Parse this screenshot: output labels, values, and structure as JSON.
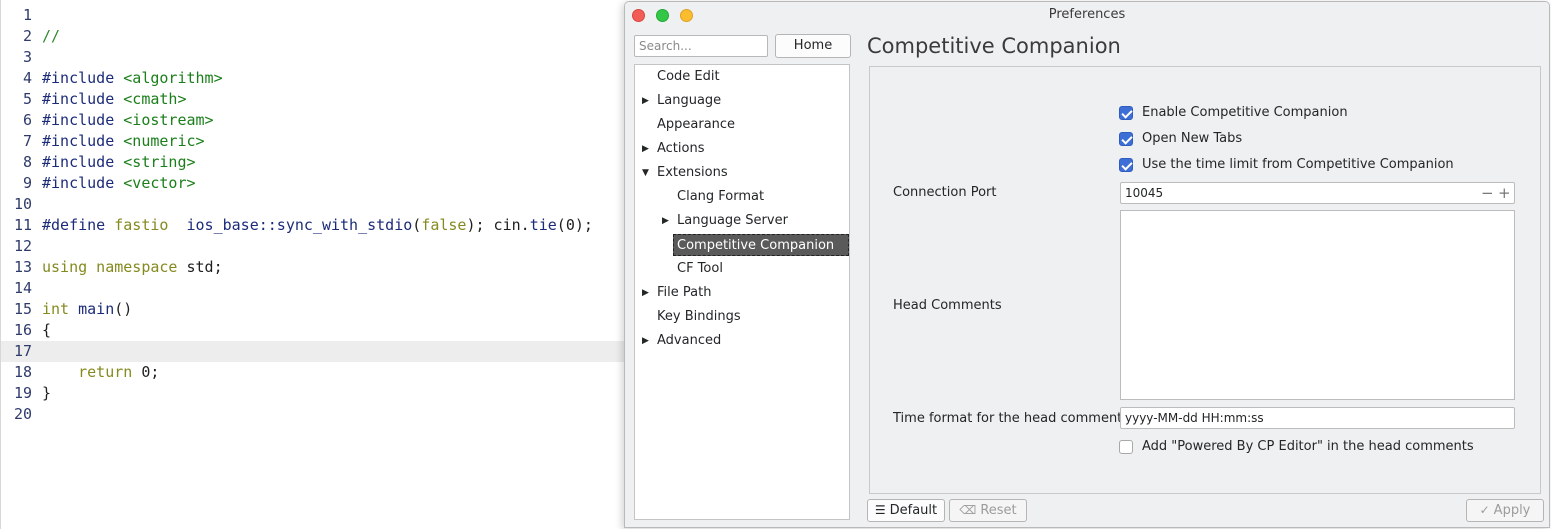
{
  "editor": {
    "lines": [
      {
        "n": "1",
        "tokens": []
      },
      {
        "n": "2",
        "tokens": [
          {
            "t": "//",
            "c": "com"
          }
        ]
      },
      {
        "n": "3",
        "tokens": []
      },
      {
        "n": "4",
        "tokens": [
          {
            "t": "#include ",
            "c": "pp"
          },
          {
            "t": "<algorithm>",
            "c": "inc"
          }
        ]
      },
      {
        "n": "5",
        "tokens": [
          {
            "t": "#include ",
            "c": "pp"
          },
          {
            "t": "<cmath>",
            "c": "inc"
          }
        ]
      },
      {
        "n": "6",
        "tokens": [
          {
            "t": "#include ",
            "c": "pp"
          },
          {
            "t": "<iostream>",
            "c": "inc"
          }
        ]
      },
      {
        "n": "7",
        "tokens": [
          {
            "t": "#include ",
            "c": "pp"
          },
          {
            "t": "<numeric>",
            "c": "inc"
          }
        ]
      },
      {
        "n": "8",
        "tokens": [
          {
            "t": "#include ",
            "c": "pp"
          },
          {
            "t": "<string>",
            "c": "inc"
          }
        ]
      },
      {
        "n": "9",
        "tokens": [
          {
            "t": "#include ",
            "c": "pp"
          },
          {
            "t": "<vector>",
            "c": "inc"
          }
        ]
      },
      {
        "n": "10",
        "tokens": []
      },
      {
        "n": "11",
        "tokens": [
          {
            "t": "#define ",
            "c": "pp"
          },
          {
            "t": "fastio  ",
            "c": "kw"
          },
          {
            "t": "ios_base::sync_with_stdio",
            "c": "fn"
          },
          {
            "t": "(",
            "c": ""
          },
          {
            "t": "false",
            "c": "kw"
          },
          {
            "t": "); cin.",
            "c": ""
          },
          {
            "t": "tie",
            "c": "fn"
          },
          {
            "t": "(",
            "c": ""
          },
          {
            "t": "0",
            "c": "num"
          },
          {
            "t": ");",
            "c": ""
          }
        ]
      },
      {
        "n": "12",
        "tokens": []
      },
      {
        "n": "13",
        "tokens": [
          {
            "t": "using namespace ",
            "c": "kw"
          },
          {
            "t": "std;",
            "c": ""
          }
        ]
      },
      {
        "n": "14",
        "tokens": []
      },
      {
        "n": "15",
        "tokens": [
          {
            "t": "int ",
            "c": "kw"
          },
          {
            "t": "main",
            "c": "fn"
          },
          {
            "t": "()",
            "c": ""
          }
        ]
      },
      {
        "n": "16",
        "tokens": [
          {
            "t": "{",
            "c": ""
          }
        ]
      },
      {
        "n": "17",
        "tokens": [],
        "current": true
      },
      {
        "n": "18",
        "tokens": [
          {
            "t": "    ",
            "c": ""
          },
          {
            "t": "return ",
            "c": "kw"
          },
          {
            "t": "0;",
            "c": ""
          }
        ]
      },
      {
        "n": "19",
        "tokens": [
          {
            "t": "}",
            "c": ""
          }
        ]
      },
      {
        "n": "20",
        "tokens": []
      }
    ]
  },
  "window": {
    "title": "Preferences",
    "search_placeholder": "Search...",
    "home_label": "Home"
  },
  "tree": [
    {
      "label": "Code Edit",
      "level": 0,
      "arrow": "",
      "selected": false
    },
    {
      "label": "Language",
      "level": 0,
      "arrow": "▶",
      "selected": false
    },
    {
      "label": "Appearance",
      "level": 0,
      "arrow": "",
      "selected": false
    },
    {
      "label": "Actions",
      "level": 0,
      "arrow": "▶",
      "selected": false
    },
    {
      "label": "Extensions",
      "level": 0,
      "arrow": "▼",
      "selected": false
    },
    {
      "label": "Clang Format",
      "level": 1,
      "arrow": "",
      "selected": false
    },
    {
      "label": "Language Server",
      "level": 1,
      "arrow": "▶",
      "selected": false
    },
    {
      "label": "Competitive Companion",
      "level": 1,
      "arrow": "",
      "selected": true
    },
    {
      "label": "CF Tool",
      "level": 1,
      "arrow": "",
      "selected": false
    },
    {
      "label": "File Path",
      "level": 0,
      "arrow": "▶",
      "selected": false
    },
    {
      "label": "Key Bindings",
      "level": 0,
      "arrow": "",
      "selected": false
    },
    {
      "label": "Advanced",
      "level": 0,
      "arrow": "▶",
      "selected": false
    }
  ],
  "page": {
    "title": "Competitive Companion",
    "checks": [
      {
        "label": "Enable Competitive Companion",
        "checked": true
      },
      {
        "label": "Open New Tabs",
        "checked": true
      },
      {
        "label": "Use the time limit from Competitive Companion",
        "checked": true
      }
    ],
    "port_label": "Connection Port",
    "port_value": "10045",
    "stepper_minus": "−",
    "stepper_plus": "+",
    "head_comments_label": "Head Comments",
    "time_format_label": "Time format for the head comments",
    "time_format_value": "yyyy-MM-dd HH:mm:ss",
    "powered_by_label": "Add \"Powered By CP Editor\" in the head comments",
    "powered_by_checked": false
  },
  "buttons": {
    "default": "Default",
    "reset": "Reset",
    "apply": "Apply"
  },
  "icons": {
    "default": "list-icon",
    "reset": "backspace-icon",
    "apply": "checkmark-icon"
  }
}
